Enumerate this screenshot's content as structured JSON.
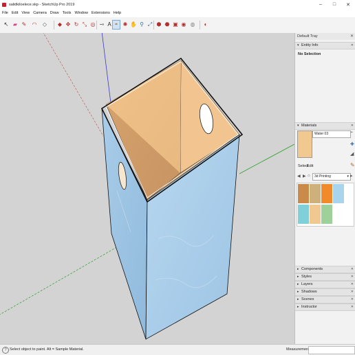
{
  "window": {
    "title": "salidkiloelece.skp - SketchUp Pro 2019",
    "minimize": "–",
    "maximize": "□",
    "close": "✕"
  },
  "menu": [
    "File",
    "Edit",
    "View",
    "Camera",
    "Draw",
    "Tools",
    "Window",
    "Extensions",
    "Help"
  ],
  "toolbar": {
    "tools": [
      {
        "icon": "select-arrow-icon",
        "glyph": "↖"
      },
      {
        "icon": "eraser-icon",
        "glyph": "▰"
      },
      {
        "icon": "pencil-icon",
        "glyph": "✎"
      },
      {
        "icon": "arc-icon",
        "glyph": "◠"
      },
      {
        "icon": "shapes-icon",
        "glyph": "◇"
      },
      {
        "icon": "push-pull-icon",
        "glyph": "◆"
      },
      {
        "icon": "move-icon",
        "glyph": "✥"
      },
      {
        "icon": "rotate-icon",
        "glyph": "↻"
      },
      {
        "icon": "scale-icon",
        "glyph": "⤡"
      },
      {
        "icon": "offset-icon",
        "glyph": "◎"
      },
      {
        "icon": "tape-measure-icon",
        "glyph": "⊸"
      },
      {
        "icon": "text-icon",
        "glyph": "A"
      },
      {
        "icon": "paint-bucket-icon",
        "glyph": "◓"
      },
      {
        "icon": "orbit-icon",
        "glyph": "✺"
      },
      {
        "icon": "pan-icon",
        "glyph": "✋"
      },
      {
        "icon": "zoom-icon",
        "glyph": "⚲"
      },
      {
        "icon": "zoom-extents-icon",
        "glyph": "⤢"
      },
      {
        "icon": "warehouse-icon",
        "glyph": "⬢"
      },
      {
        "icon": "extension-warehouse-icon",
        "glyph": "⬣"
      },
      {
        "icon": "layout-icon",
        "glyph": "▣"
      },
      {
        "icon": "extension-manager-icon",
        "glyph": "◉"
      },
      {
        "icon": "trimble-connect-icon",
        "glyph": "◍"
      },
      {
        "icon": "sketchup-logo-icon",
        "glyph": "◐"
      }
    ]
  },
  "status": {
    "text": "Select object to paint. Alt = Sample Material.",
    "measurements_label": "Measurements",
    "info_glyph": "?"
  },
  "tray": {
    "title": "Default Tray",
    "close_glyph": "✕",
    "entity_info": {
      "header": "Entity Info",
      "value": "No Selection"
    },
    "materials": {
      "header": "Materials",
      "material_name": "Water 03",
      "tabs": {
        "select": "Select",
        "edit": "Edit"
      },
      "library": "3d Printing",
      "swatches": [
        "#c98a4a",
        "#cdb07a",
        "#f08a2a",
        "#a9d4ee",
        "#7fd0d8",
        "#f0c890",
        "#9ed09a"
      ]
    },
    "sections": [
      "Components",
      "Styles",
      "Layers",
      "Shadows",
      "Scenes",
      "Instructor"
    ]
  }
}
